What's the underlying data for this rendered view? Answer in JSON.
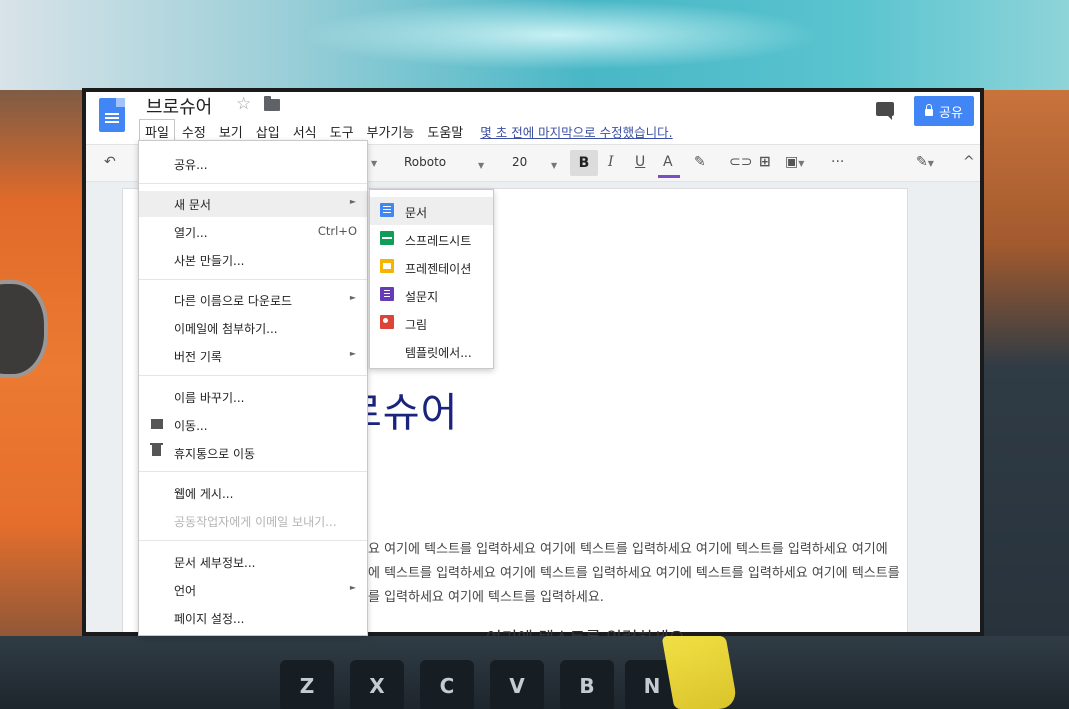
{
  "doc": {
    "title": "브로슈어",
    "star": "☆",
    "last_edit": "몇 초 전에 마지막으로 수정했습니다."
  },
  "menus": [
    "파일",
    "수정",
    "보기",
    "삽입",
    "서식",
    "도구",
    "부가기능",
    "도움말"
  ],
  "share": {
    "label": "공유"
  },
  "toolbar": {
    "font": "Roboto",
    "size": "20",
    "bold": "B",
    "italic": "I",
    "underline": "U",
    "text_color": "A",
    "more": "···"
  },
  "file_menu": {
    "share": "공유...",
    "new_document": "새 문서",
    "open": "열기...",
    "open_shortcut": "Ctrl+O",
    "make_copy": "사본 만들기...",
    "download_as": "다른 이름으로 다운로드",
    "email_attach": "이메일에 첨부하기...",
    "version_history": "버전 기록",
    "rename": "이름 바꾸기...",
    "move": "이동...",
    "move_to_trash": "휴지통으로 이동",
    "publish_web": "웹에 게시...",
    "email_collaborators": "공동작업자에게 이메일 보내기...",
    "doc_details": "문서 세부정보...",
    "language": "언어",
    "page_setup": "페이지 설정..."
  },
  "new_submenu": {
    "document": "문서",
    "spreadsheet": "스프레드시트",
    "presentation": "프레젠테이션",
    "form": "설문지",
    "drawing": "그림",
    "from_template": "템플릿에서..."
  },
  "page": {
    "big_title": "로슈어",
    "line1": "요 여기에 텍스트를 입력하세요 여기에 텍스트를 입력하세요 여기에 텍스트를 입력하세요 여기에",
    "line2": "에 텍스트를 입력하세요 여기에 텍스트를 입력하세요 여기에 텍스트를 입력하세요 여기에 텍스트를",
    "line3": "를 입력하세요 여기에 텍스트를 입력하세요.",
    "subheading": "여기에 텍스트를 입력하세요"
  },
  "background_keys": [
    "Z",
    "X",
    "C",
    "V",
    "B",
    "N"
  ],
  "colors": {
    "accent": "#4285f4",
    "title_text": "#1a237e",
    "link_text": "#3b4fa3"
  }
}
